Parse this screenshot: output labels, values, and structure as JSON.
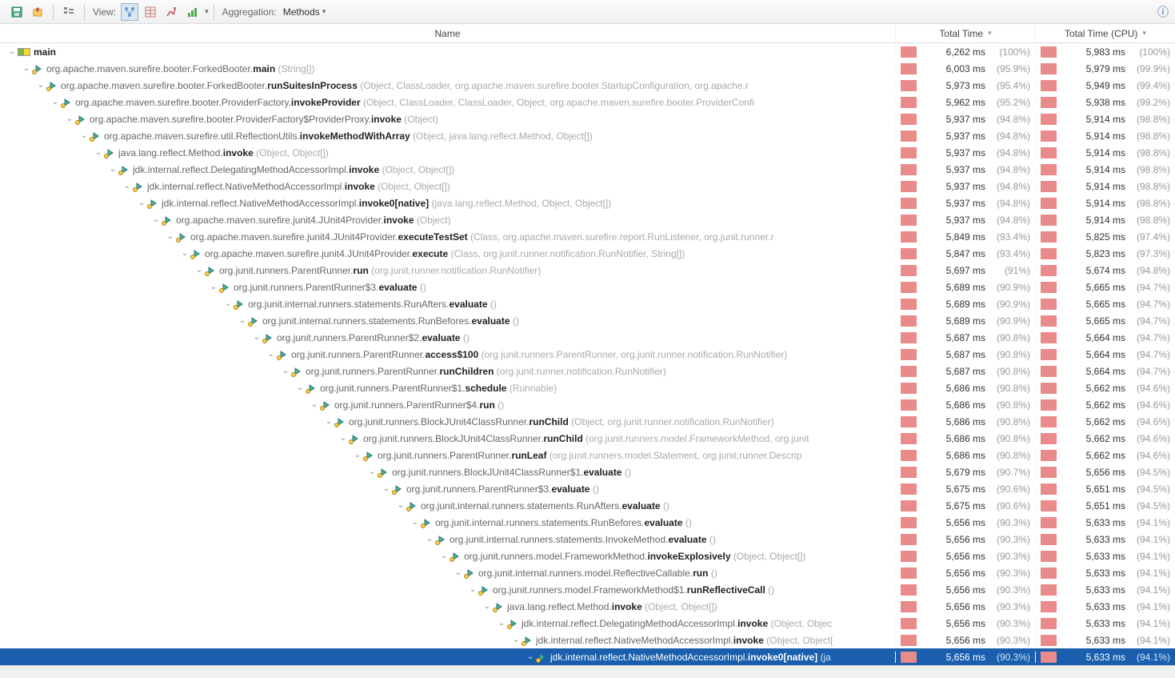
{
  "toolbar": {
    "view_label": "View:",
    "aggregation_label": "Aggregation:",
    "aggregation_value": "Methods"
  },
  "columns": {
    "name": "Name",
    "total_time": "Total Time",
    "total_cpu": "Total Time (CPU)"
  },
  "rows": [
    {
      "depth": 0,
      "thread": true,
      "pkg": "",
      "method": "main",
      "params": "",
      "time": "6,262 ms",
      "pct": "(100%)",
      "cpu": "5,983 ms",
      "cpct": "(100%)"
    },
    {
      "depth": 1,
      "pkg": "org.apache.maven.surefire.booter.ForkedBooter.",
      "method": "main",
      "params": " (String[])",
      "time": "6,003 ms",
      "pct": "(95.9%)",
      "cpu": "5,979 ms",
      "cpct": "(99.9%)"
    },
    {
      "depth": 2,
      "pkg": "org.apache.maven.surefire.booter.ForkedBooter.",
      "method": "runSuitesInProcess",
      "params": " (Object, ClassLoader, org.apache.maven.surefire.booter.StartupConfiguration, org.apache.r",
      "time": "5,973 ms",
      "pct": "(95.4%)",
      "cpu": "5,949 ms",
      "cpct": "(99.4%)"
    },
    {
      "depth": 3,
      "pkg": "org.apache.maven.surefire.booter.ProviderFactory.",
      "method": "invokeProvider",
      "params": " (Object, ClassLoader, ClassLoader, Object, org.apache.maven.surefire.booter.ProviderConfi",
      "time": "5,962 ms",
      "pct": "(95.2%)",
      "cpu": "5,938 ms",
      "cpct": "(99.2%)"
    },
    {
      "depth": 4,
      "pkg": "org.apache.maven.surefire.booter.ProviderFactory$ProviderProxy.",
      "method": "invoke",
      "params": " (Object)",
      "time": "5,937 ms",
      "pct": "(94.8%)",
      "cpu": "5,914 ms",
      "cpct": "(98.8%)"
    },
    {
      "depth": 5,
      "pkg": "org.apache.maven.surefire.util.ReflectionUtils.",
      "method": "invokeMethodWithArray",
      "params": " (Object, java.lang.reflect.Method, Object[])",
      "time": "5,937 ms",
      "pct": "(94.8%)",
      "cpu": "5,914 ms",
      "cpct": "(98.8%)"
    },
    {
      "depth": 6,
      "pkg": "java.lang.reflect.Method.",
      "method": "invoke",
      "params": " (Object, Object[])",
      "time": "5,937 ms",
      "pct": "(94.8%)",
      "cpu": "5,914 ms",
      "cpct": "(98.8%)"
    },
    {
      "depth": 7,
      "pkg": "jdk.internal.reflect.DelegatingMethodAccessorImpl.",
      "method": "invoke",
      "params": " (Object, Object[])",
      "time": "5,937 ms",
      "pct": "(94.8%)",
      "cpu": "5,914 ms",
      "cpct": "(98.8%)"
    },
    {
      "depth": 8,
      "pkg": "jdk.internal.reflect.NativeMethodAccessorImpl.",
      "method": "invoke",
      "params": " (Object, Object[])",
      "time": "5,937 ms",
      "pct": "(94.8%)",
      "cpu": "5,914 ms",
      "cpct": "(98.8%)"
    },
    {
      "depth": 9,
      "pkg": "jdk.internal.reflect.NativeMethodAccessorImpl.",
      "method": "invoke0[native]",
      "params": " (java.lang.reflect.Method, Object, Object[])",
      "time": "5,937 ms",
      "pct": "(94.8%)",
      "cpu": "5,914 ms",
      "cpct": "(98.8%)"
    },
    {
      "depth": 10,
      "pkg": "org.apache.maven.surefire.junit4.JUnit4Provider.",
      "method": "invoke",
      "params": " (Object)",
      "time": "5,937 ms",
      "pct": "(94.8%)",
      "cpu": "5,914 ms",
      "cpct": "(98.8%)"
    },
    {
      "depth": 11,
      "pkg": "org.apache.maven.surefire.junit4.JUnit4Provider.",
      "method": "executeTestSet",
      "params": " (Class, org.apache.maven.surefire.report.RunListener, org.junit.runner.r",
      "time": "5,849 ms",
      "pct": "(93.4%)",
      "cpu": "5,825 ms",
      "cpct": "(97.4%)"
    },
    {
      "depth": 12,
      "pkg": "org.apache.maven.surefire.junit4.JUnit4Provider.",
      "method": "execute",
      "params": " (Class, org.junit.runner.notification.RunNotifier, String[])",
      "time": "5,847 ms",
      "pct": "(93.4%)",
      "cpu": "5,823 ms",
      "cpct": "(97.3%)"
    },
    {
      "depth": 13,
      "pkg": "org.junit.runners.ParentRunner.",
      "method": "run",
      "params": " (org.junit.runner.notification.RunNotifier)",
      "time": "5,697 ms",
      "pct": "(91%)",
      "cpu": "5,674 ms",
      "cpct": "(94.8%)"
    },
    {
      "depth": 14,
      "pkg": "org.junit.runners.ParentRunner$3.",
      "method": "evaluate",
      "params": " ()",
      "time": "5,689 ms",
      "pct": "(90.9%)",
      "cpu": "5,665 ms",
      "cpct": "(94.7%)"
    },
    {
      "depth": 15,
      "pkg": "org.junit.internal.runners.statements.RunAfters.",
      "method": "evaluate",
      "params": " ()",
      "time": "5,689 ms",
      "pct": "(90.9%)",
      "cpu": "5,665 ms",
      "cpct": "(94.7%)"
    },
    {
      "depth": 16,
      "pkg": "org.junit.internal.runners.statements.RunBefores.",
      "method": "evaluate",
      "params": " ()",
      "time": "5,689 ms",
      "pct": "(90.9%)",
      "cpu": "5,665 ms",
      "cpct": "(94.7%)"
    },
    {
      "depth": 17,
      "pkg": "org.junit.runners.ParentRunner$2.",
      "method": "evaluate",
      "params": " ()",
      "time": "5,687 ms",
      "pct": "(90.8%)",
      "cpu": "5,664 ms",
      "cpct": "(94.7%)"
    },
    {
      "depth": 18,
      "pkg": "org.junit.runners.ParentRunner.",
      "method": "access$100",
      "params": " (org.junit.runners.ParentRunner, org.junit.runner.notification.RunNotifier)",
      "time": "5,687 ms",
      "pct": "(90.8%)",
      "cpu": "5,664 ms",
      "cpct": "(94.7%)"
    },
    {
      "depth": 19,
      "pkg": "org.junit.runners.ParentRunner.",
      "method": "runChildren",
      "params": " (org.junit.runner.notification.RunNotifier)",
      "time": "5,687 ms",
      "pct": "(90.8%)",
      "cpu": "5,664 ms",
      "cpct": "(94.7%)"
    },
    {
      "depth": 20,
      "pkg": "org.junit.runners.ParentRunner$1.",
      "method": "schedule",
      "params": " (Runnable)",
      "time": "5,686 ms",
      "pct": "(90.8%)",
      "cpu": "5,662 ms",
      "cpct": "(94.6%)"
    },
    {
      "depth": 21,
      "pkg": "org.junit.runners.ParentRunner$4.",
      "method": "run",
      "params": " ()",
      "time": "5,686 ms",
      "pct": "(90.8%)",
      "cpu": "5,662 ms",
      "cpct": "(94.6%)"
    },
    {
      "depth": 22,
      "pkg": "org.junit.runners.BlockJUnit4ClassRunner.",
      "method": "runChild",
      "params": " (Object, org.junit.runner.notification.RunNotifier)",
      "time": "5,686 ms",
      "pct": "(90.8%)",
      "cpu": "5,662 ms",
      "cpct": "(94.6%)"
    },
    {
      "depth": 23,
      "pkg": "org.junit.runners.BlockJUnit4ClassRunner.",
      "method": "runChild",
      "params": " (org.junit.runners.model.FrameworkMethod, org.junit",
      "time": "5,686 ms",
      "pct": "(90.8%)",
      "cpu": "5,662 ms",
      "cpct": "(94.6%)"
    },
    {
      "depth": 24,
      "pkg": "org.junit.runners.ParentRunner.",
      "method": "runLeaf",
      "params": " (org.junit.runners.model.Statement, org.junit.runner.Descrip",
      "time": "5,686 ms",
      "pct": "(90.8%)",
      "cpu": "5,662 ms",
      "cpct": "(94.6%)"
    },
    {
      "depth": 25,
      "pkg": "org.junit.runners.BlockJUnit4ClassRunner$1.",
      "method": "evaluate",
      "params": " ()",
      "time": "5,679 ms",
      "pct": "(90.7%)",
      "cpu": "5,656 ms",
      "cpct": "(94.5%)"
    },
    {
      "depth": 26,
      "pkg": "org.junit.runners.ParentRunner$3.",
      "method": "evaluate",
      "params": " ()",
      "time": "5,675 ms",
      "pct": "(90.6%)",
      "cpu": "5,651 ms",
      "cpct": "(94.5%)"
    },
    {
      "depth": 27,
      "pkg": "org.junit.internal.runners.statements.RunAfters.",
      "method": "evaluate",
      "params": " ()",
      "time": "5,675 ms",
      "pct": "(90.6%)",
      "cpu": "5,651 ms",
      "cpct": "(94.5%)"
    },
    {
      "depth": 28,
      "pkg": "org.junit.internal.runners.statements.RunBefores.",
      "method": "evaluate",
      "params": " ()",
      "time": "5,656 ms",
      "pct": "(90.3%)",
      "cpu": "5,633 ms",
      "cpct": "(94.1%)"
    },
    {
      "depth": 29,
      "pkg": "org.junit.internal.runners.statements.InvokeMethod.",
      "method": "evaluate",
      "params": " ()",
      "time": "5,656 ms",
      "pct": "(90.3%)",
      "cpu": "5,633 ms",
      "cpct": "(94.1%)"
    },
    {
      "depth": 30,
      "pkg": "org.junit.runners.model.FrameworkMethod.",
      "method": "invokeExplosively",
      "params": " (Object, Object[])",
      "time": "5,656 ms",
      "pct": "(90.3%)",
      "cpu": "5,633 ms",
      "cpct": "(94.1%)"
    },
    {
      "depth": 31,
      "pkg": "org.junit.internal.runners.model.ReflectiveCallable.",
      "method": "run",
      "params": " ()",
      "time": "5,656 ms",
      "pct": "(90.3%)",
      "cpu": "5,633 ms",
      "cpct": "(94.1%)"
    },
    {
      "depth": 32,
      "pkg": "org.junit.runners.model.FrameworkMethod$1.",
      "method": "runReflectiveCall",
      "params": " ()",
      "time": "5,656 ms",
      "pct": "(90.3%)",
      "cpu": "5,633 ms",
      "cpct": "(94.1%)"
    },
    {
      "depth": 33,
      "pkg": "java.lang.reflect.Method.",
      "method": "invoke",
      "params": " (Object, Object[])",
      "time": "5,656 ms",
      "pct": "(90.3%)",
      "cpu": "5,633 ms",
      "cpct": "(94.1%)"
    },
    {
      "depth": 34,
      "pkg": "jdk.internal.reflect.DelegatingMethodAccessorImpl.",
      "method": "invoke",
      "params": " (Object, Objec",
      "time": "5,656 ms",
      "pct": "(90.3%)",
      "cpu": "5,633 ms",
      "cpct": "(94.1%)"
    },
    {
      "depth": 35,
      "pkg": "jdk.internal.reflect.NativeMethodAccessorImpl.",
      "method": "invoke",
      "params": " (Object, Object[",
      "time": "5,656 ms",
      "pct": "(90.3%)",
      "cpu": "5,633 ms",
      "cpct": "(94.1%)"
    },
    {
      "depth": 36,
      "selected": true,
      "pkg": "jdk.internal.reflect.NativeMethodAccessorImpl.",
      "method": "invoke0[native]",
      "params": " (ja",
      "time": "5,656 ms",
      "pct": "(90.3%)",
      "cpu": "5,633 ms",
      "cpct": "(94.1%)"
    }
  ]
}
